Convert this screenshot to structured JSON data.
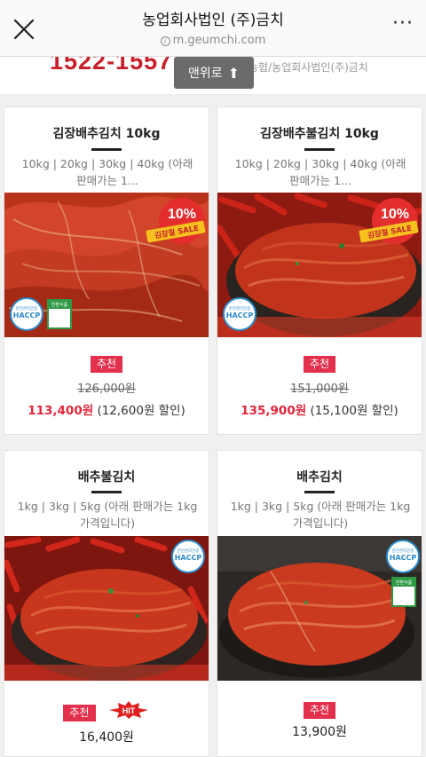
{
  "browser": {
    "title": "농업회사법인 (주)금치",
    "url": "m.geumchi.com",
    "close_icon": "close-icon",
    "more_icon": "more-icon"
  },
  "header_strip": {
    "phone_partial": "1522-1557",
    "company_path": "농협/농업회사법인(주)금치"
  },
  "back_to_top": {
    "label": "맨위로",
    "icon": "arrow-up-icon"
  },
  "colors": {
    "accent": "#e3304c",
    "sale_price": "#e3263b",
    "phone": "#c8202a"
  },
  "products": [
    {
      "title": "김장배추김치 10kg",
      "description": "10kg | 20kg | 30kg | 40kg (아래 판매가는 1...",
      "sale_badge": "김장철 SALE",
      "sale_pct": "10%",
      "cert_haccp": "HACCP",
      "cert_haccp_top": "안전관리인증",
      "cert_green": "친환식품",
      "recommend": "추천",
      "original_price": "126,000원",
      "sale_price": "113,400원",
      "discount": "(12,600원 할인)"
    },
    {
      "title": "김장배추불김치 10kg",
      "description": "10kg | 20kg | 30kg | 40kg (아래 판매가는 1...",
      "sale_badge": "김장철 SALE",
      "sale_pct": "10%",
      "cert_haccp": "HACCP",
      "cert_haccp_top": "안전관리인증",
      "recommend": "추천",
      "original_price": "151,000원",
      "sale_price": "135,900원",
      "discount": "(15,100원 할인)"
    },
    {
      "title": "배추불김치",
      "description": "1kg | 3kg | 5kg (아래 판매가는 1kg 가격입니다)",
      "cert_haccp": "HACCP",
      "cert_haccp_top": "안전관리인증",
      "recommend": "추천",
      "hit": "HIT",
      "price": "16,400원"
    },
    {
      "title": "배추김치",
      "description": "1kg | 3kg | 5kg (아래 판매가는 1kg 가격입니다)",
      "cert_haccp": "HACCP",
      "cert_haccp_top": "안전관리인증",
      "cert_green": "친환식품",
      "recommend": "추천",
      "price": "13,900원"
    }
  ]
}
